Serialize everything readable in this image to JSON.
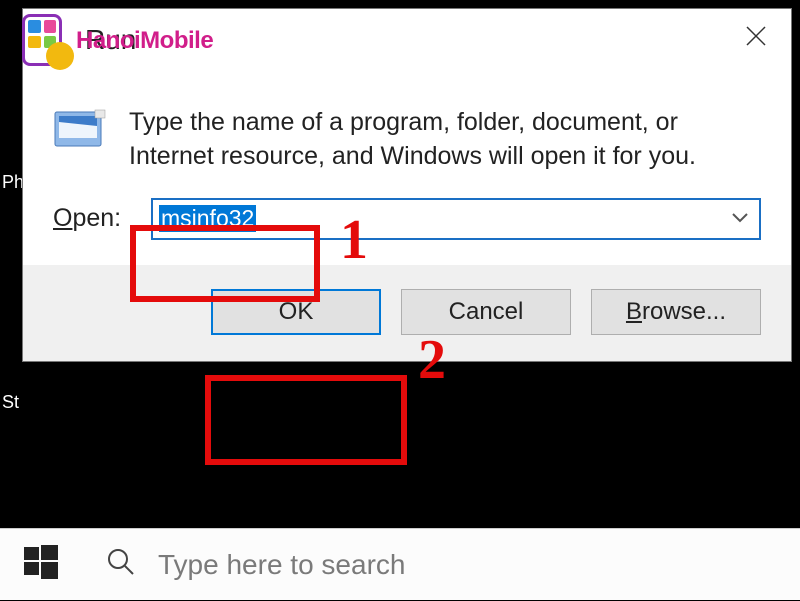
{
  "window": {
    "title": "Run",
    "instruction": "Type the name of a program, folder, document, or Internet resource, and Windows will open it for you.",
    "open_label_prefix": "O",
    "open_label_rest": "pen:",
    "input_value": "msinfo32",
    "buttons": {
      "ok": "OK",
      "cancel": "Cancel",
      "browse_prefix": "B",
      "browse_rest": "rowse..."
    }
  },
  "taskbar": {
    "search_placeholder": "Type here to search"
  },
  "annotations": {
    "step1": "1",
    "step2": "2"
  },
  "watermark": {
    "text": "HanoiMobile"
  },
  "desktop_fragments": {
    "ph": "Ph",
    "st": "St"
  }
}
